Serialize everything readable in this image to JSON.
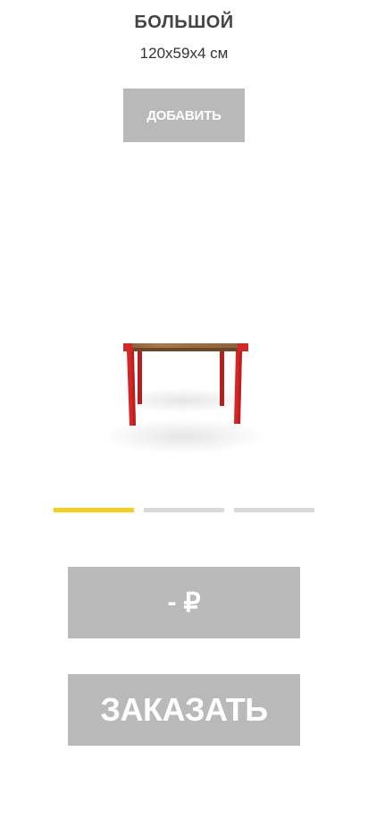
{
  "product": {
    "title": "БОЛЬШОЙ",
    "size": "120x59x4 см",
    "image_icon": "table-image",
    "image_colors": {
      "top": "#9a6b3e",
      "legs": "#d52626"
    }
  },
  "actions": {
    "add_label": "ДОБАВИТЬ",
    "order_label": "ЗАКАЗАТЬ"
  },
  "price": {
    "value": "-",
    "currency": "₽"
  },
  "pager": {
    "count": 3,
    "active_index": 0,
    "active_color": "#f5cf1a",
    "inactive_color": "#d9d9d9"
  },
  "colors": {
    "button_bg": "#b9b9b9",
    "button_text": "#ffffff"
  }
}
